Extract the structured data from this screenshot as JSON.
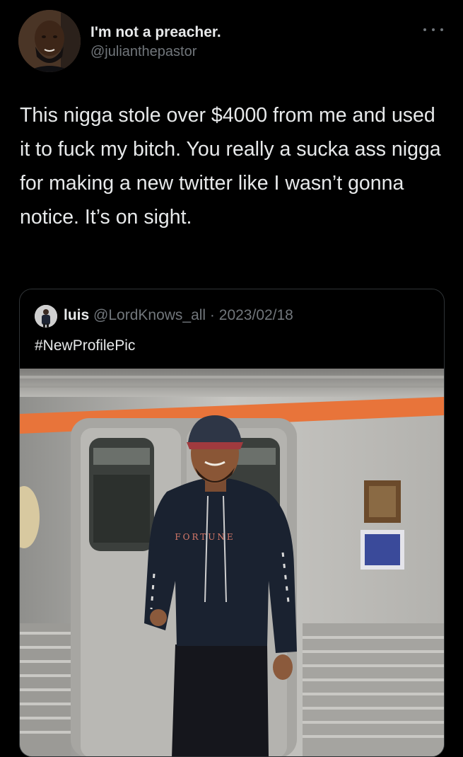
{
  "author": {
    "display_name": "I'm not a preacher.",
    "handle": "@julianthepastor"
  },
  "tweet": {
    "text": "This nigga stole over $4000 from me and used it to fuck my bitch. You really a sucka ass nigga for making a new twitter like I wasn’t gonna notice. It’s on sight."
  },
  "quoted_tweet": {
    "display_name": "luis",
    "meta": "@LordKnows_all · 2023/02/18",
    "text": "#NewProfilePic",
    "hoodie_text": "FORTUNE"
  },
  "icons": {
    "more": "more-horizontal-icon"
  },
  "colors": {
    "background": "#000000",
    "text_primary": "#e7e9ea",
    "text_secondary": "#71767b",
    "border": "#2f3336",
    "train_stripe": "#e8743a"
  }
}
